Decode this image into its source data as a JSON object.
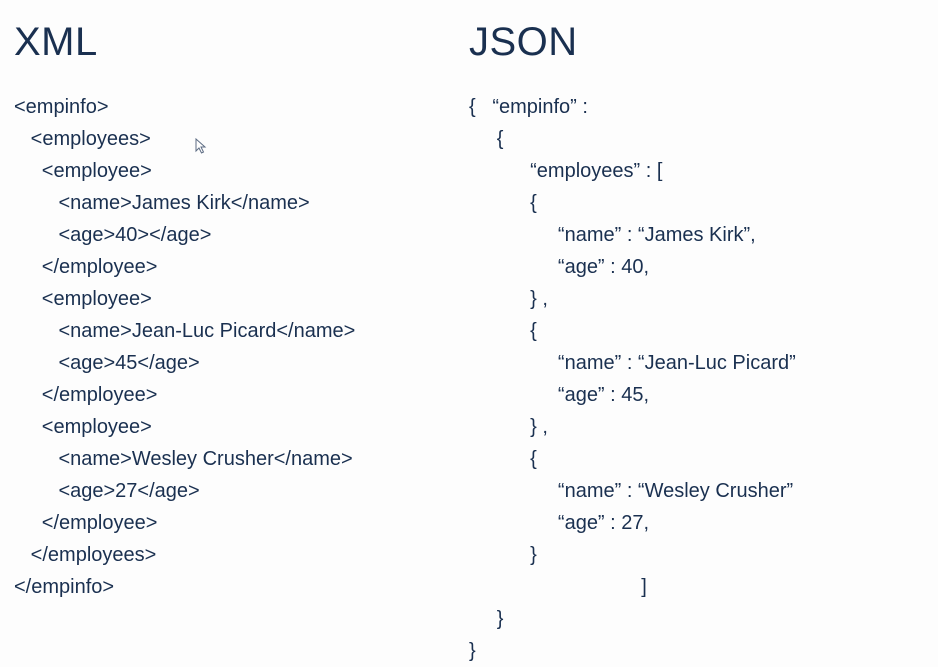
{
  "left": {
    "heading": "XML",
    "lines": [
      "<empinfo>",
      "   <employees>",
      "     <employee>",
      "        <name>James Kirk</name>",
      "        <age>40></age>",
      "     </employee>",
      "     <employee>",
      "        <name>Jean-Luc Picard</name>",
      "        <age>45</age>",
      "     </employee>",
      "     <employee>",
      "        <name>Wesley Crusher</name>",
      "        <age>27</age>",
      "     </employee>",
      "   </employees>",
      "</empinfo>"
    ]
  },
  "right": {
    "heading": "JSON",
    "lines": [
      "{   “empinfo” :",
      "     {",
      "           “employees” : [",
      "           {",
      "                “name” : “James Kirk”,",
      "                “age” : 40,",
      "           } ,",
      "           {",
      "                “name” : “Jean-Luc Picard”",
      "                “age” : 45,",
      "           } ,",
      "           {",
      "                “name” : “Wesley Crusher”",
      "                “age” : 27,",
      "           }",
      "                               ]",
      "     }",
      "}"
    ]
  },
  "cursor_glyph": "↱"
}
